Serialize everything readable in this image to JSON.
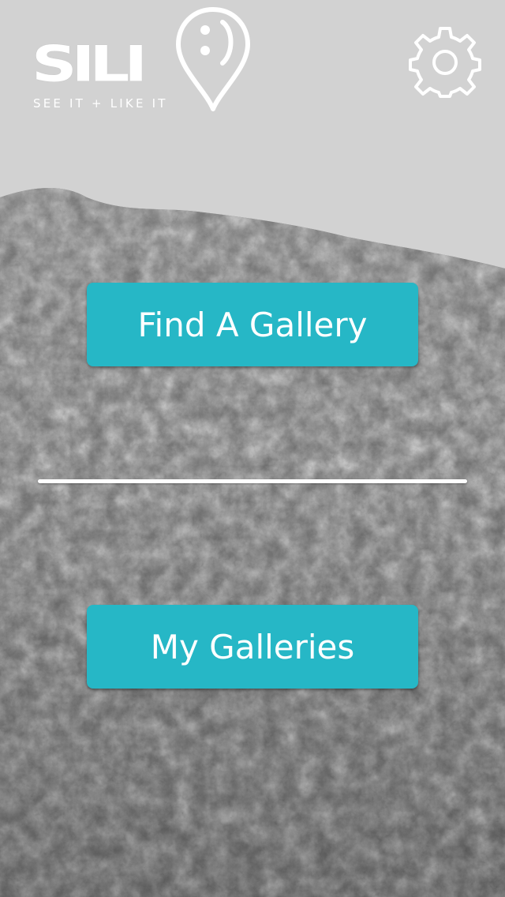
{
  "app": {
    "logo_text": "SILI",
    "tagline": "SEE IT + LIKE IT"
  },
  "icons": {
    "logo_pin": "map-pin-smiley-icon",
    "settings": "gear-icon"
  },
  "actions": {
    "find_gallery_label": "Find A Gallery",
    "my_galleries_label": "My Galleries"
  },
  "colors": {
    "accent": "#26b7c6",
    "sky": "#d2d2d2",
    "text_on_accent": "#ffffff"
  }
}
